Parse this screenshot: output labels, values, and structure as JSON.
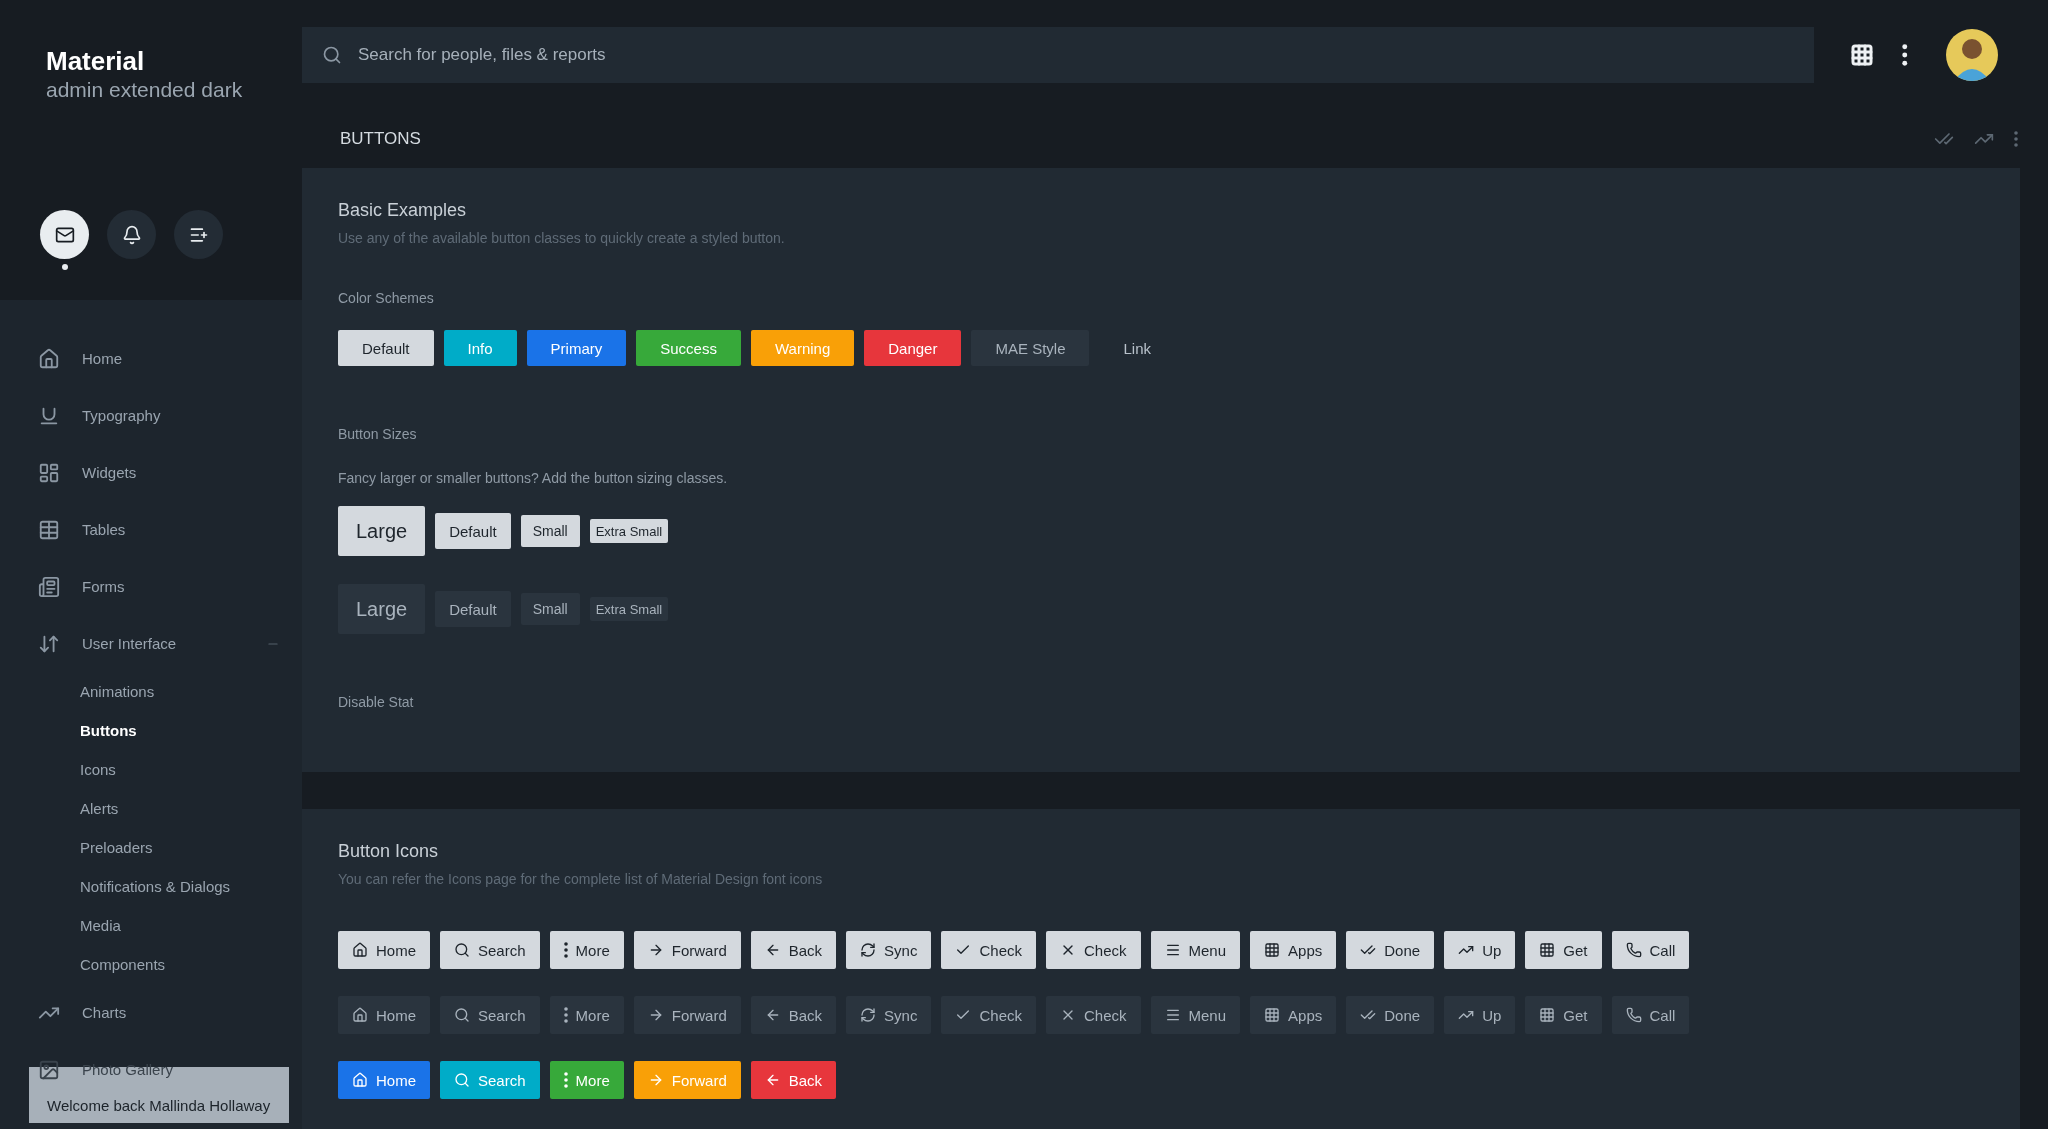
{
  "brand": {
    "title": "Material",
    "subtitle": "admin extended dark"
  },
  "search": {
    "placeholder": "Search for people, files & reports"
  },
  "quick_actions": [
    {
      "selected": true
    },
    {
      "selected": false
    },
    {
      "selected": false
    }
  ],
  "sidebar": {
    "items": [
      {
        "label": "Home"
      },
      {
        "label": "Typography"
      },
      {
        "label": "Widgets"
      },
      {
        "label": "Tables"
      },
      {
        "label": "Forms"
      },
      {
        "label": "User Interface",
        "expanded": true,
        "children": [
          {
            "label": "Animations",
            "selected": false
          },
          {
            "label": "Buttons",
            "selected": true
          },
          {
            "label": "Icons",
            "selected": false
          },
          {
            "label": "Alerts",
            "selected": false
          },
          {
            "label": "Preloaders",
            "selected": false
          },
          {
            "label": "Notifications & Dialogs",
            "selected": false
          },
          {
            "label": "Media",
            "selected": false
          },
          {
            "label": "Components",
            "selected": false
          }
        ]
      },
      {
        "label": "Charts"
      },
      {
        "label": "Photo Gallery"
      }
    ]
  },
  "toast": {
    "text": "Welcome back Mallinda Hollaway"
  },
  "page_title": "BUTTONS",
  "basic_card": {
    "title": "Basic Examples",
    "description": "Use any of the available button classes to quickly create a styled button.",
    "color_schemes": {
      "heading": "Color Schemes",
      "buttons": [
        {
          "label": "Default",
          "kind": "default"
        },
        {
          "label": "Info",
          "kind": "info"
        },
        {
          "label": "Primary",
          "kind": "primary"
        },
        {
          "label": "Success",
          "kind": "success"
        },
        {
          "label": "Warning",
          "kind": "warning"
        },
        {
          "label": "Danger",
          "kind": "danger"
        },
        {
          "label": "MAE Style",
          "kind": "mae"
        },
        {
          "label": "Link",
          "kind": "link"
        }
      ]
    },
    "sizes": {
      "heading": "Button Sizes",
      "description": "Fancy larger or smaller buttons? Add the button sizing classes.",
      "rows": [
        {
          "kind": "default",
          "buttons": [
            {
              "label": "Large",
              "kind": "large"
            },
            {
              "label": "Default",
              "kind": "default"
            },
            {
              "label": "Small",
              "kind": "small"
            },
            {
              "label": "Extra Small",
              "kind": "xsmall"
            }
          ]
        },
        {
          "kind": "mae",
          "buttons": [
            {
              "label": "Large",
              "kind": "large"
            },
            {
              "label": "Default",
              "kind": "default"
            },
            {
              "label": "Small",
              "kind": "small"
            },
            {
              "label": "Extra Small",
              "kind": "xsmall"
            }
          ]
        }
      ]
    },
    "disable_heading": "Disable Stat"
  },
  "icons_card": {
    "title": "Button Icons",
    "description": "You can refer the Icons page for the complete list of Material Design font icons",
    "rows": [
      {
        "buttons": [
          {
            "label": "Home",
            "kind": "default"
          },
          {
            "label": "Search",
            "kind": "default"
          },
          {
            "label": "More",
            "kind": "default"
          },
          {
            "label": "Forward",
            "kind": "default"
          },
          {
            "label": "Back",
            "kind": "default"
          },
          {
            "label": "Sync",
            "kind": "default"
          },
          {
            "label": "Check",
            "kind": "default"
          },
          {
            "label": "Check",
            "kind": "default"
          },
          {
            "label": "Menu",
            "kind": "default"
          },
          {
            "label": "Apps",
            "kind": "default"
          },
          {
            "label": "Done",
            "kind": "default"
          },
          {
            "label": "Up",
            "kind": "default"
          },
          {
            "label": "Get",
            "kind": "default"
          },
          {
            "label": "Call",
            "kind": "default"
          }
        ]
      },
      {
        "buttons": [
          {
            "label": "Home",
            "kind": "mae"
          },
          {
            "label": "Search",
            "kind": "mae"
          },
          {
            "label": "More",
            "kind": "mae"
          },
          {
            "label": "Forward",
            "kind": "mae"
          },
          {
            "label": "Back",
            "kind": "mae"
          },
          {
            "label": "Sync",
            "kind": "mae"
          },
          {
            "label": "Check",
            "kind": "mae"
          },
          {
            "label": "Check",
            "kind": "mae"
          },
          {
            "label": "Menu",
            "kind": "mae"
          },
          {
            "label": "Apps",
            "kind": "mae"
          },
          {
            "label": "Done",
            "kind": "mae"
          },
          {
            "label": "Up",
            "kind": "mae"
          },
          {
            "label": "Get",
            "kind": "mae"
          },
          {
            "label": "Call",
            "kind": "mae"
          }
        ]
      },
      {
        "buttons": [
          {
            "label": "Home",
            "kind": "primary"
          },
          {
            "label": "Search",
            "kind": "info"
          },
          {
            "label": "More",
            "kind": "success"
          },
          {
            "label": "Forward",
            "kind": "warning"
          },
          {
            "label": "Back",
            "kind": "danger"
          }
        ]
      }
    ]
  }
}
